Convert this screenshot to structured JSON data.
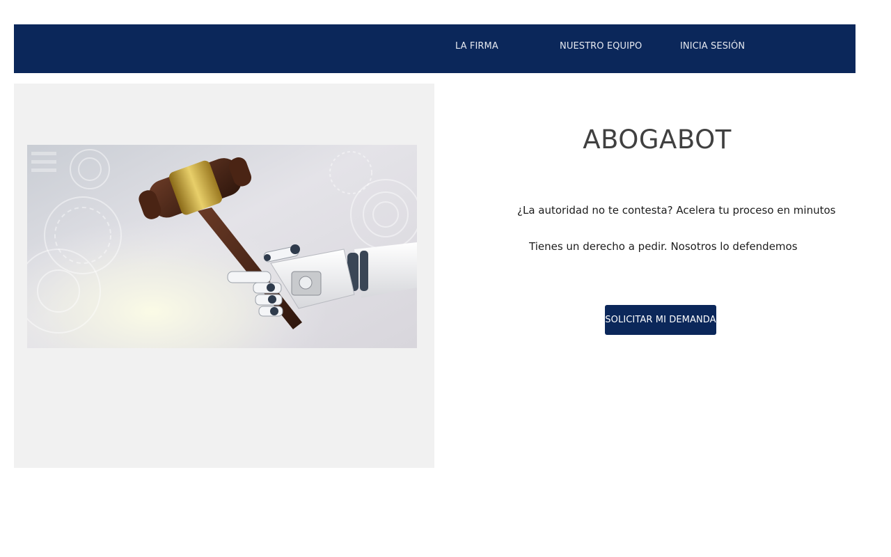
{
  "nav": {
    "items": [
      {
        "label": "LA FIRMA"
      },
      {
        "label": "NUESTRO EQUIPO"
      },
      {
        "label": "INICIA SESIÓN"
      }
    ]
  },
  "hero": {
    "image": "robot-hand-holding-gavel"
  },
  "main": {
    "title": "ABOGABOT",
    "tagline_1": "¿La autoridad no te contesta? Acelera tu proceso en minutos",
    "tagline_2": "Tienes un derecho a pedir. Nosotros lo defendemos",
    "cta_label": "SOLICITAR MI DEMANDA"
  },
  "colors": {
    "brand_navy": "#0b275a",
    "panel_gray": "#f1f1f1",
    "title_gray": "#404040"
  }
}
